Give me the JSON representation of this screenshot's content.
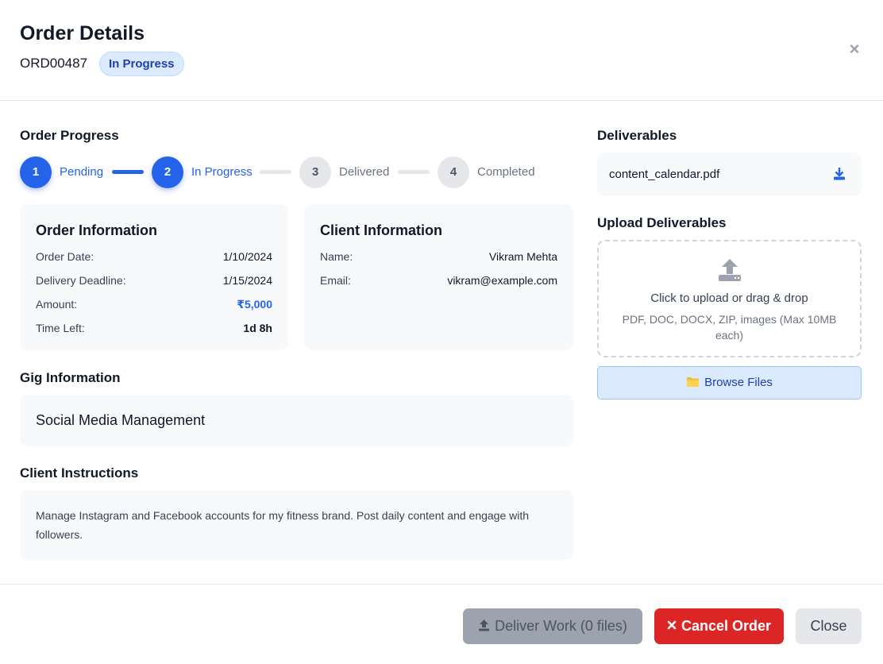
{
  "header": {
    "title": "Order Details",
    "order_id": "ORD00487",
    "status": "In Progress",
    "close_symbol": "×"
  },
  "progress": {
    "title": "Order Progress",
    "current_step": 2,
    "steps": [
      {
        "number": "1",
        "label": "Pending"
      },
      {
        "number": "2",
        "label": "In Progress"
      },
      {
        "number": "3",
        "label": "Delivered"
      },
      {
        "number": "4",
        "label": "Completed"
      }
    ]
  },
  "order_info": {
    "title": "Order Information",
    "rows": [
      {
        "label": "Order Date:",
        "value": "1/10/2024"
      },
      {
        "label": "Delivery Deadline:",
        "value": "1/15/2024"
      },
      {
        "label": "Amount:",
        "value": "₹5,000"
      },
      {
        "label": "Time Left:",
        "value": "1d 8h"
      }
    ]
  },
  "client_info": {
    "title": "Client Information",
    "rows": [
      {
        "label": "Name:",
        "value": "Vikram Mehta"
      },
      {
        "label": "Email:",
        "value": "vikram@example.com"
      }
    ]
  },
  "gig": {
    "title": "Gig Information",
    "name": "Social Media Management"
  },
  "instructions": {
    "title": "Client Instructions",
    "text": "Manage Instagram and Facebook accounts for my fitness brand. Post daily content and engage with followers."
  },
  "deliverables": {
    "title": "Deliverables",
    "files": [
      {
        "name": "content_calendar.pdf",
        "icon": "download-icon"
      }
    ]
  },
  "upload": {
    "title": "Upload Deliverables",
    "prompt": "Click to upload or drag & drop",
    "hint": "PDF, DOC, DOCX, ZIP, images (Max 10MB each)",
    "browse_label": "Browse Files",
    "icon": "upload-icon"
  },
  "footer": {
    "deliver_label": "Deliver Work (0 files)",
    "cancel_label": "Cancel Order",
    "close_label": "Close"
  },
  "colors": {
    "accent": "#2563eb",
    "badge_bg": "#dbeafe",
    "badge_text": "#1e40af",
    "danger": "#dc2626",
    "disabled": "#9ca3af",
    "card_bg": "#f8f9fb"
  }
}
